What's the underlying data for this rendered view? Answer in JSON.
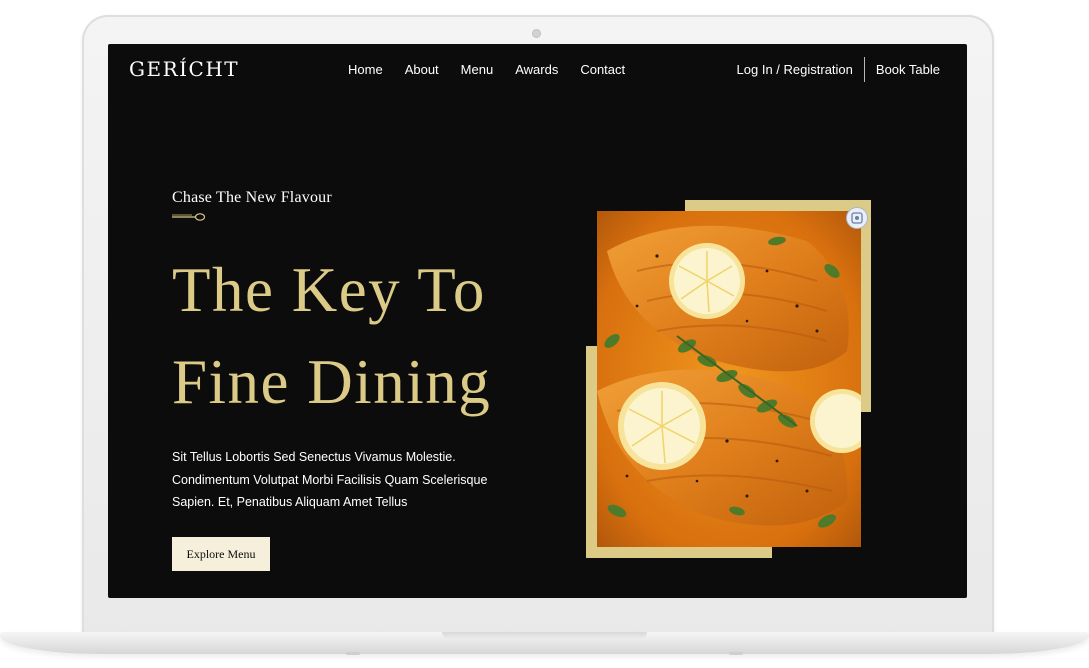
{
  "brand": {
    "logo_text": "GERÍCHT"
  },
  "nav": {
    "items": [
      {
        "label": "Home"
      },
      {
        "label": "About"
      },
      {
        "label": "Menu"
      },
      {
        "label": "Awards"
      },
      {
        "label": "Contact"
      }
    ]
  },
  "auth": {
    "login_label": "Log In / Registration",
    "book_label": "Book Table"
  },
  "hero": {
    "subtitle": "Chase The New Flavour",
    "title_line1": "The Key To",
    "title_line2": "Fine Dining",
    "description": "Sit Tellus Lobortis Sed Senectus Vivamus Molestie. Condimentum Volutpat Morbi Facilisis Quam Scelerisque Sapien. Et, Penatibus Aliquam Amet Tellus",
    "cta_label": "Explore Menu",
    "image_icon": "salmon-dish-photo"
  },
  "colors": {
    "background": "#0c0c0c",
    "accent_gold": "#dcca87",
    "button_bg": "#f5efdb",
    "text": "#ffffff"
  }
}
